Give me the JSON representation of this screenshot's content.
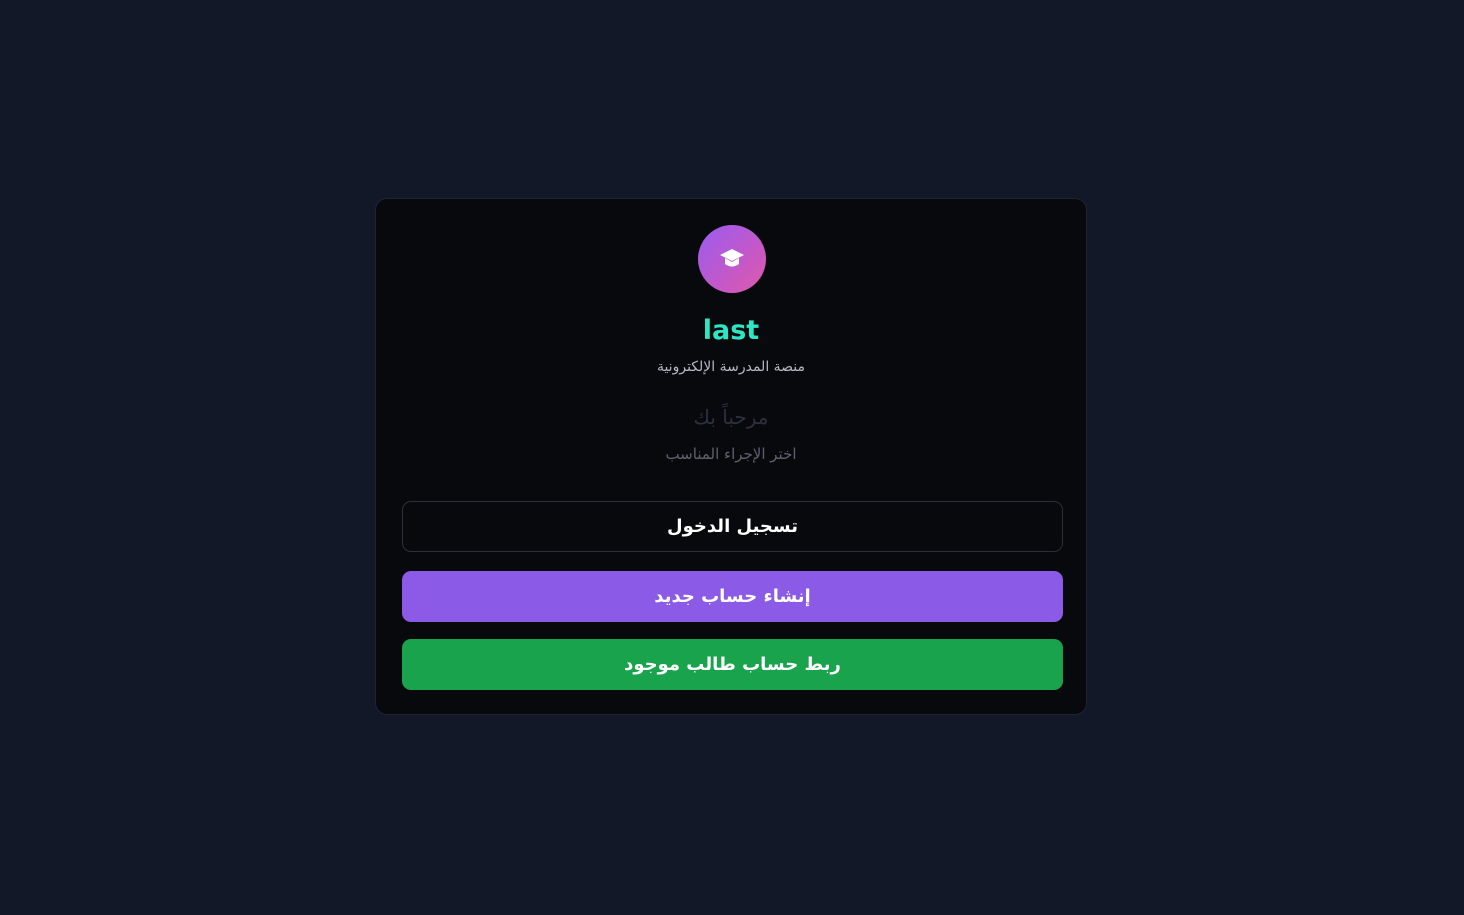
{
  "brand": {
    "name": "last",
    "subtitle": "منصة المدرسة الإلكترونية",
    "icon": "graduation-cap-icon",
    "accent_color": "#2ee6c4"
  },
  "welcome": {
    "title": "مرحباً بك",
    "hint": "اختر الإجراء المناسب"
  },
  "actions": {
    "login_label": "تسجيل الدخول",
    "register_label": "إنشاء حساب جديد",
    "link_student_label": "ربط حساب طالب موجود",
    "register_color": "#8b5ae6",
    "link_student_color": "#19a34c"
  }
}
